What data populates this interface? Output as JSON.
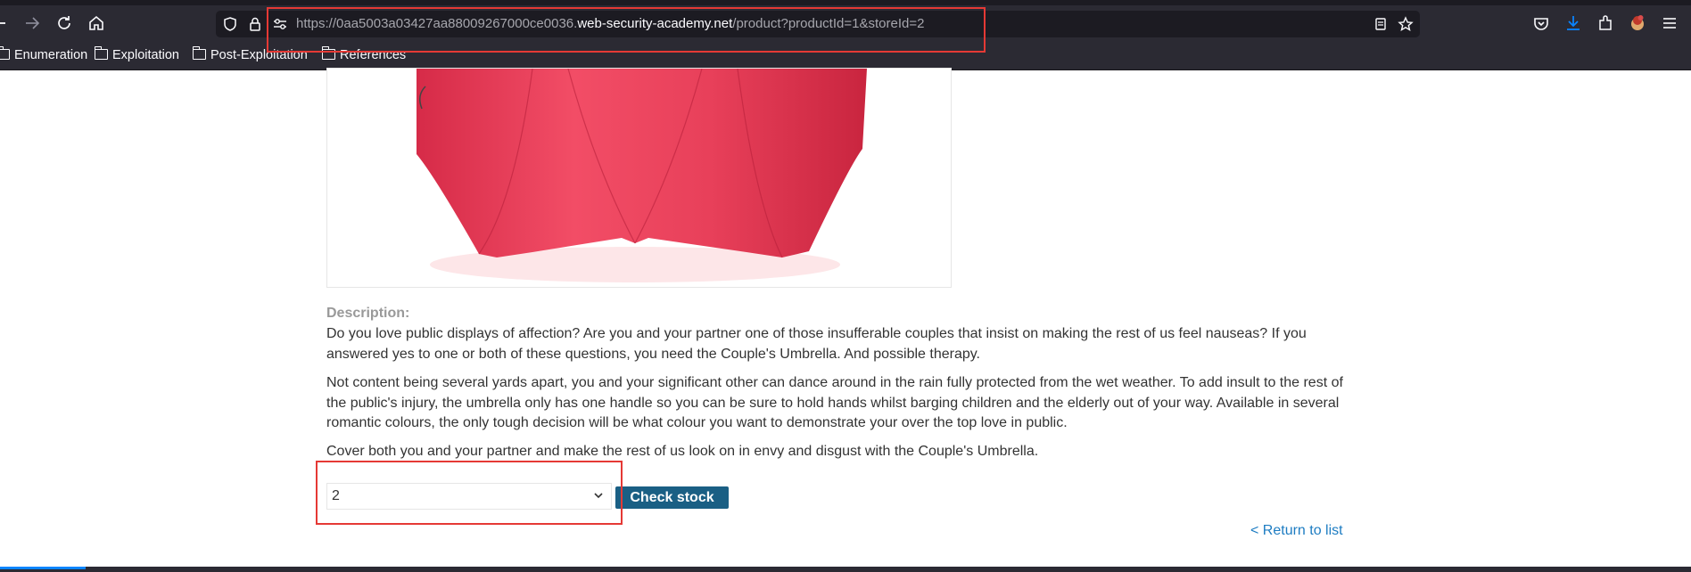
{
  "browser": {
    "url_prefix": "https://0aa5003a03427aa88009267000ce0036.",
    "url_host": "web-security-academy.net",
    "url_path": "/product?productId=1&storeId=2",
    "nav_icons": [
      "back-icon",
      "forward-icon",
      "reload-icon",
      "home-icon"
    ],
    "right_icons": [
      "pocket-icon",
      "downloads-icon",
      "extensions-icon",
      "account-icon",
      "menu-icon"
    ],
    "bookmarks": [
      {
        "label": "Enumeration"
      },
      {
        "label": "Exploitation"
      },
      {
        "label": "Post-Exploitation"
      },
      {
        "label": "References"
      }
    ]
  },
  "product": {
    "description_label": "Description:",
    "paragraphs": [
      "Do you love public displays of affection? Are you and your partner one of those insufferable couples that insist on making the rest of us feel nauseas? If you answered yes to one or both of these questions, you need the Couple's Umbrella. And possible therapy.",
      "Not content being several yards apart, you and your significant other can dance around in the rain fully protected from the wet weather. To add insult to the rest of the public's injury, the umbrella only has one handle so you can be sure to hold hands whilst barging children and the elderly out of your way. Available in several romantic colours, the only tough decision will be what colour you want to demonstrate your over the top love in public.",
      "Cover both you and your partner and make the rest of us look on in envy and disgust with the Couple's Umbrella."
    ],
    "store_select_value": "2",
    "check_stock_label": "Check stock",
    "return_link": "< Return to list"
  },
  "colors": {
    "annotation": "#e53935",
    "button": "#1a5f84",
    "link": "#1d7cc2"
  }
}
